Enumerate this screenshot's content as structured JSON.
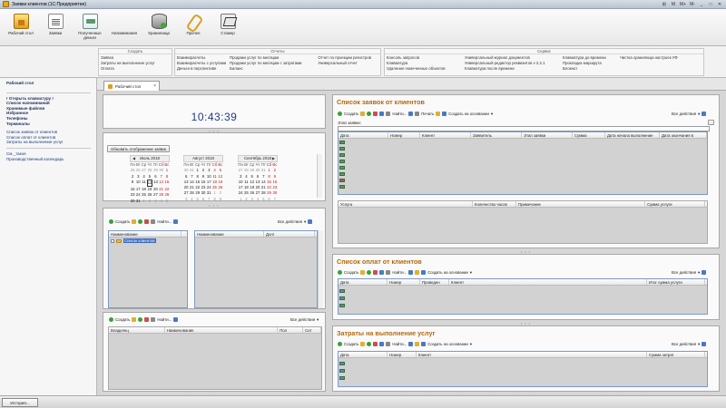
{
  "window": {
    "title": "Заявки клиентов  (1С:Предприятие)",
    "controls": [
      "⊞",
      "M",
      "M+",
      "M-",
      "_",
      "□",
      "✕"
    ]
  },
  "toolbar": [
    {
      "label": "Рабочий стол",
      "icon": "desk"
    },
    {
      "label": "Заявки",
      "icon": "doc"
    },
    {
      "label": "Полученные деньги",
      "icon": "money"
    },
    {
      "label": "Напоминания",
      "icon": "cal"
    },
    {
      "label": "Хранилища",
      "icon": "store"
    },
    {
      "label": "Прочее",
      "icon": "clip"
    },
    {
      "label": "Стажер",
      "icon": "star"
    }
  ],
  "sections": {
    "create": {
      "title": "Создать",
      "items": [
        "Заявка",
        "Затраты на выполнение услуг",
        "Оплата"
      ]
    },
    "reports": {
      "title": "Отчеты",
      "col1": [
        "Взаиморасчеты",
        "Взаиморасчеты с услугами",
        "Деньги в перспективе"
      ],
      "col2": [
        "Продажи услуг по месяцам",
        "Продажи услуг по месяцам с затратами",
        "Баланс"
      ],
      "col3": [
        "Отчет по проекции регистров",
        "Универсальный отчет"
      ]
    },
    "service": {
      "title": "Сервис",
      "col1": [
        "Консоль запросов",
        "Клавиатура",
        "Удаление помеченных объектов"
      ],
      "col2": [
        "Универсальный журнал документов",
        "Универсальный редактор реквизитов v 2.2.1",
        "Клавиатура после времени"
      ],
      "col3": [
        "Клавиатура до времени",
        "Прокладка маршрута",
        "Блокнот"
      ],
      "col4": [
        "Чистка хранилища настроек УФ"
      ]
    }
  },
  "sidebar": {
    "title": "Рабочий стол",
    "bold_items": [
      "! Открыть клавиатуру !",
      "Список напоминаний",
      "Хранимые файлов",
      "Избранное",
      "Телефоны",
      "Терминалы"
    ],
    "links": [
      "Список заявок от клиентов",
      "Список оплат от клиентов",
      "Затраты на выполнение услуг"
    ],
    "extra": [
      "См._такое",
      "Производственный календарь"
    ]
  },
  "tab": {
    "label": "Рабочий стол"
  },
  "clock": "10:43:39",
  "refresh_button": "Обновить отображение заявок",
  "calendar": {
    "day_names": [
      "Пн",
      "Вт",
      "Ср",
      "Чт",
      "Пт",
      "Сб",
      "Вс"
    ],
    "months": [
      {
        "title": "Июль 2018",
        "days": [
          "25",
          "26",
          "27",
          "28",
          "29",
          "30",
          "1",
          "2",
          "3",
          "4",
          "5",
          "6",
          "7",
          "8",
          "9",
          "10",
          "11",
          "12",
          "13",
          "14",
          "15",
          "16",
          "17",
          "18",
          "19",
          "20",
          "21",
          "22",
          "23",
          "24",
          "25",
          "26",
          "27",
          "28",
          "29",
          "30",
          "31",
          "1",
          "2",
          "3",
          "4",
          "5"
        ],
        "prev_count": 6,
        "next_from": 37,
        "today_index": 17
      },
      {
        "title": "Август 2018",
        "days": [
          "30",
          "31",
          "1",
          "2",
          "3",
          "4",
          "5",
          "6",
          "7",
          "8",
          "9",
          "10",
          "11",
          "12",
          "13",
          "14",
          "15",
          "16",
          "17",
          "18",
          "19",
          "20",
          "21",
          "22",
          "23",
          "24",
          "25",
          "26",
          "27",
          "28",
          "29",
          "30",
          "31",
          "1",
          "2",
          "3",
          "4",
          "5",
          "6",
          "7",
          "8",
          "9"
        ],
        "prev_count": 2,
        "next_from": 33,
        "today_index": -1
      },
      {
        "title": "Сентябрь 2018",
        "days": [
          "27",
          "28",
          "29",
          "30",
          "31",
          "1",
          "2",
          "3",
          "4",
          "5",
          "6",
          "7",
          "8",
          "9",
          "10",
          "11",
          "12",
          "13",
          "14",
          "15",
          "16",
          "17",
          "18",
          "19",
          "20",
          "21",
          "22",
          "23",
          "24",
          "25",
          "26",
          "27",
          "28",
          "29",
          "30",
          "1",
          "2",
          "3",
          "4",
          "5",
          "6",
          "7"
        ],
        "prev_count": 5,
        "next_from": 35,
        "today_index": -1
      }
    ]
  },
  "left_toolbar1": {
    "create": "Создать",
    "find": "Найти...",
    "all_actions": "Все действия"
  },
  "tree1": {
    "col": "Наименование",
    "root": "Список клиентов"
  },
  "tree2": {
    "col1": "Наименование",
    "col2": "Долг"
  },
  "left_toolbar2": {
    "create": "Создать",
    "find": "Найти...",
    "all_actions": "Все действия"
  },
  "files_table": {
    "cols": [
      "Владелец",
      "Наименование",
      "Пол",
      "Сот"
    ]
  },
  "requests": {
    "title": "Список заявок от клиентов",
    "create": "Создать",
    "find": "Найти...",
    "print": "Печать",
    "create_based": "Создать на основании",
    "all_actions": "Все действия",
    "filter_label": "Этап заявки:",
    "cols": [
      "Дата",
      "Номер",
      "Клиент",
      "Заявитель",
      "Этап заявки",
      "Сумма",
      "Дата начала выполнение",
      "Дата окончания в"
    ],
    "sub_cols": [
      "Услуга",
      "Количество часов",
      "Примечание",
      "Сумма услуги"
    ]
  },
  "payments": {
    "title": "Список оплат от клиентов",
    "create": "Создать",
    "find": "Найти...",
    "create_based": "Создать на основании",
    "all_actions": "Все действия",
    "cols": [
      "Дата",
      "Номер",
      "Проведен",
      "Клиент",
      "Итог сумма услуги"
    ]
  },
  "costs": {
    "title": "Затраты на выполнение услуг",
    "create": "Создать",
    "find": "Найти...",
    "create_based": "Создать на основании",
    "all_actions": "Все действия",
    "cols": [
      "Дата",
      "Номер",
      "Клиент",
      "Сумма затрат"
    ]
  },
  "status": {
    "history": "История..."
  }
}
